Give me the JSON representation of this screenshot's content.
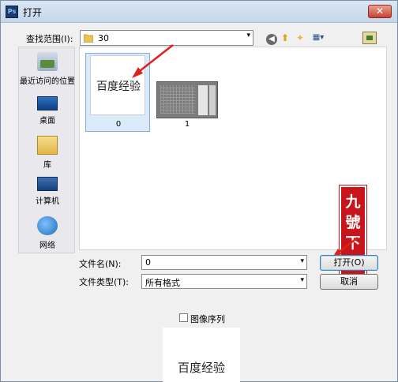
{
  "window": {
    "title": "打开",
    "app_icon": "Ps",
    "close_symbol": "✕"
  },
  "lookin": {
    "label": "查找范围(I):",
    "value": "30",
    "arrow": "▾"
  },
  "toolbar": {
    "back_icon": "◀",
    "up_icon": "⬆",
    "new_folder_icon": "✦",
    "view_icon": "▦▾"
  },
  "places": [
    {
      "label": "最近访问的位置",
      "icon": "recent-places-icon"
    },
    {
      "label": "桌面",
      "icon": "desktop-icon"
    },
    {
      "label": "库",
      "icon": "library-icon"
    },
    {
      "label": "计算机",
      "icon": "computer-icon"
    },
    {
      "label": "网络",
      "icon": "network-icon"
    }
  ],
  "files": [
    {
      "name": "0",
      "thumbnail_text": "百度经验",
      "selected": true
    },
    {
      "name": "1",
      "selected": false
    }
  ],
  "watermark": {
    "text": "九號下載"
  },
  "filename": {
    "label": "文件名(N):",
    "value": "0"
  },
  "filetype": {
    "label": "文件类型(T):",
    "value": "所有格式"
  },
  "buttons": {
    "open": "打开(O)",
    "cancel": "取消"
  },
  "image_sequence": {
    "label": "图像序列",
    "checked": false
  },
  "preview": {
    "text": "百度经验"
  },
  "colors": {
    "selection": "#dbeaf9",
    "seal": "#c8151b",
    "annotation_arrow": "#e0201b"
  }
}
